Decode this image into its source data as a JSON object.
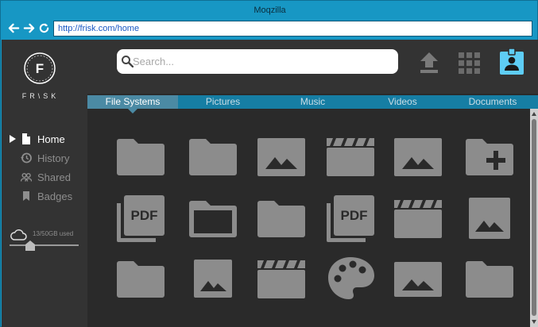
{
  "window": {
    "title": "Moqzilla"
  },
  "browser": {
    "url": "http://frisk.com/home"
  },
  "brand": {
    "logo_letter": "F",
    "name": "FR\\SK"
  },
  "sidebar": {
    "items": [
      {
        "label": "Home",
        "icon": "file-icon",
        "active": true
      },
      {
        "label": "History",
        "icon": "history-icon",
        "active": false
      },
      {
        "label": "Shared",
        "icon": "people-icon",
        "active": false
      },
      {
        "label": "Badges",
        "icon": "bookmark-icon",
        "active": false
      }
    ],
    "storage": {
      "text": "13/50GB used",
      "used_fraction": 0.26
    }
  },
  "search": {
    "placeholder": "Search..."
  },
  "toolbar": {
    "upload_icon": "upload-icon",
    "apps_icon": "grid-icon",
    "profile_icon": "badge-icon"
  },
  "tabs": [
    {
      "label": "File Systems",
      "active": true
    },
    {
      "label": "Pictures",
      "active": false
    },
    {
      "label": "Music",
      "active": false
    },
    {
      "label": "Videos",
      "active": false
    },
    {
      "label": "Documents",
      "active": false
    }
  ],
  "files": [
    [
      "folder",
      "folder",
      "image",
      "video",
      "image",
      "folder-add"
    ],
    [
      "pdf",
      "folder",
      "folder",
      "pdf",
      "video",
      "image"
    ],
    [
      "folder",
      "image",
      "video",
      "palette",
      "image",
      "folder"
    ]
  ],
  "colors": {
    "accent": "#1797c4",
    "tabbar": "#167ea4",
    "tab_active": "#4b8aa4",
    "sidebar": "#333333",
    "content": "#2a2a2a",
    "icon_gray": "#8c8c8c",
    "profile": "#5ecdf5"
  }
}
